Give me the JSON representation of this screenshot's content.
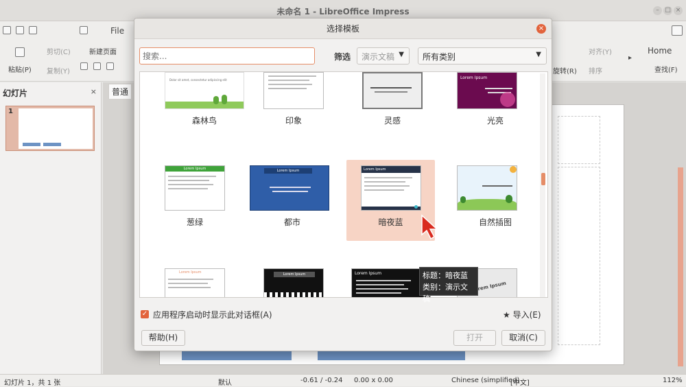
{
  "window": {
    "title": "未命名 1 - LibreOffice Impress"
  },
  "menubar": {
    "file": "File"
  },
  "toolbar": {
    "paste": "粘贴(P)",
    "cut": "剪切(C)",
    "copy": "复制(Y)",
    "new_page": "新建页面",
    "rotate": "旋转(R)",
    "align": "对齐(Y)",
    "arrange": "排序",
    "tab_home": "Home",
    "find": "查找(F)"
  },
  "slide_pane": {
    "title": "幻灯片",
    "close": "×",
    "slide_number": "1"
  },
  "view_tab": "普通",
  "dialog": {
    "title": "选择模板",
    "search_placeholder": "搜索...",
    "filter_label": "筛选",
    "filter_type": "演示文稿",
    "filter_category": "所有类别",
    "templates": [
      {
        "name": "森林鸟"
      },
      {
        "name": "印象"
      },
      {
        "name": "灵感"
      },
      {
        "name": "光亮"
      },
      {
        "name": "葱绿"
      },
      {
        "name": "都市"
      },
      {
        "name": "暗夜蓝"
      },
      {
        "name": "自然插图"
      }
    ],
    "preview_text": {
      "lorem": "Lorem Ipsum",
      "dolor": "Dolor sit amet, consectetur adipiscing elit",
      "dolor_short": "Dolor sit amet, consectetur adipiscing elit",
      "cons": "Consectetur adipiscing elit",
      "vest": "Vestibulum consequat mi quis pretium semper",
      "proin": "Proin luctus orci ac neque venenatis"
    },
    "tooltip": {
      "title": "标题：暗夜蓝",
      "category": "类别：演示文稿"
    },
    "show_on_startup": "应用程序启动时显示此对话框(A)",
    "import": "导入(E)",
    "help": "帮助(H)",
    "open": "打开",
    "cancel": "取消(C)"
  },
  "statusbar": {
    "slide_info": "幻灯片 1，共 1 张",
    "layout": "默认",
    "position": "-0.61 / -0.24",
    "size": "0.00 x 0.00",
    "language": "Chinese (simplified)",
    "ime": "[中文]",
    "zoom": "112%"
  },
  "colors": {
    "accent": "#e2633c",
    "selection": "#f7d4c5",
    "slide_blue": "#6d93c4"
  }
}
